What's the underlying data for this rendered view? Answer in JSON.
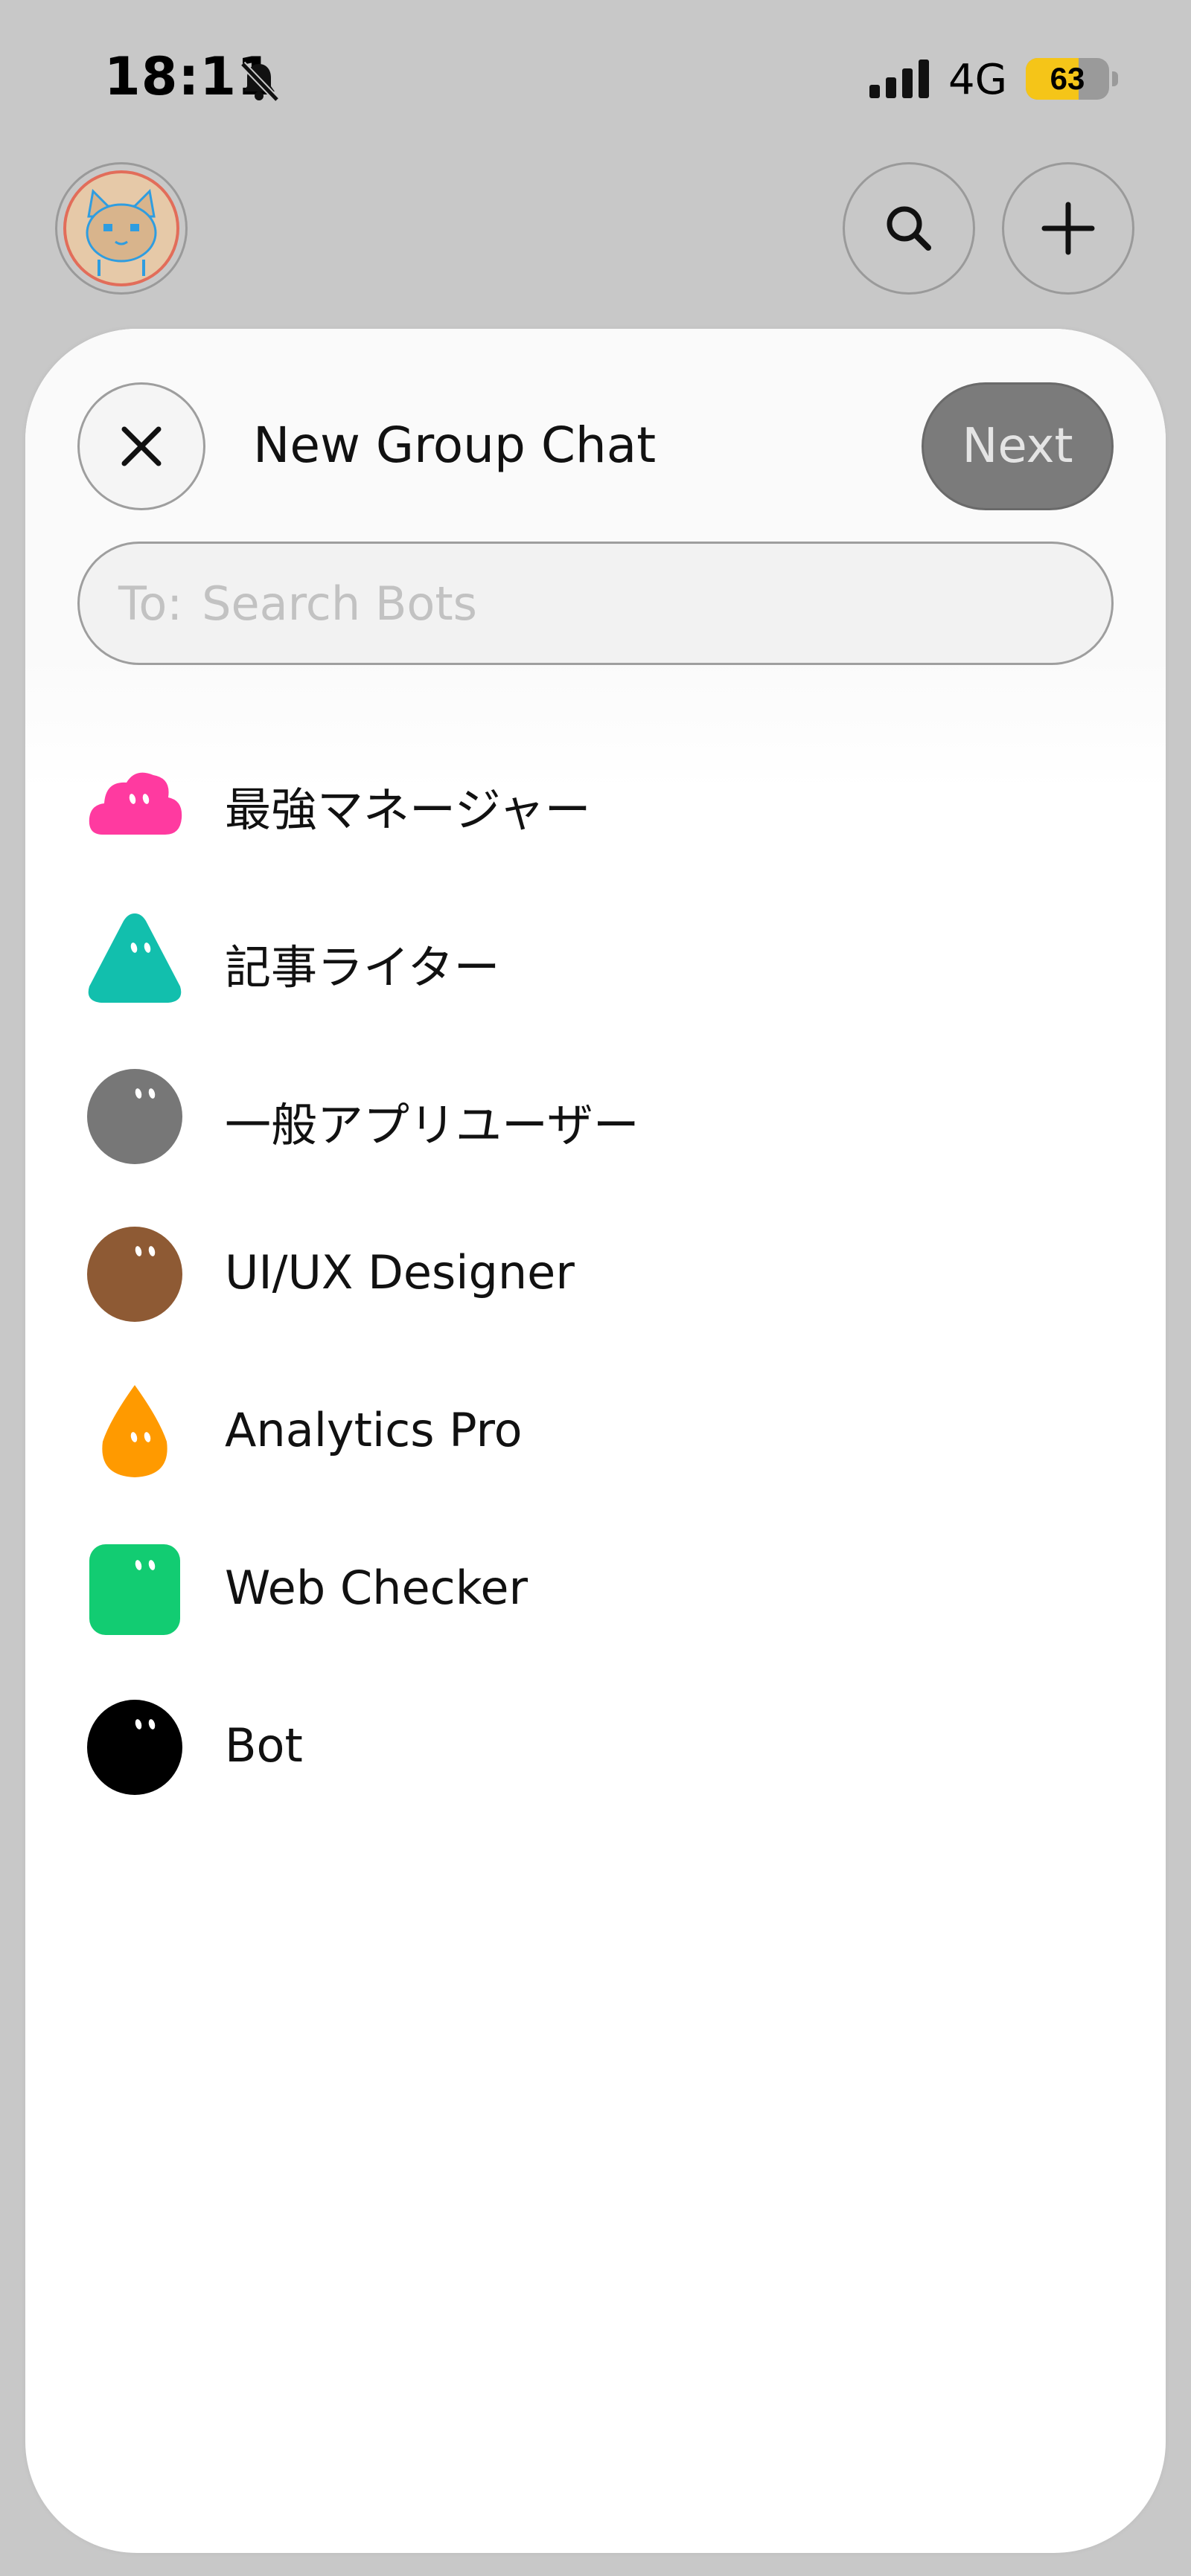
{
  "status_bar": {
    "time": "18:11",
    "network": "4G",
    "battery": "63",
    "battery_level": 0.63,
    "battery_color": "#f5c518",
    "icons": [
      "bell-slash-icon",
      "signal-bars-icon",
      "battery-icon"
    ]
  },
  "top_bar": {
    "avatar_icon": "cat-avatar-icon",
    "search_icon": "search-icon",
    "add_icon": "plus-icon"
  },
  "sheet": {
    "title": "New Group Chat",
    "close_icon": "close-icon",
    "next_label": "Next",
    "search": {
      "prefix": "To:",
      "placeholder": "Search Bots"
    }
  },
  "bots": [
    {
      "name": "最強マネージャー",
      "icon": "cloud-bot-icon",
      "color": "#ff3aa0"
    },
    {
      "name": "記事ライター",
      "icon": "triangle-bot-icon",
      "color": "#12bfad"
    },
    {
      "name": "一般アプリユーザー",
      "icon": "circle-bot-icon",
      "color": "#777777"
    },
    {
      "name": "UI/UX Designer",
      "icon": "circle-bot-icon",
      "color": "#8e5a34"
    },
    {
      "name": "Analytics Pro",
      "icon": "drop-bot-icon",
      "color": "#ff9a00"
    },
    {
      "name": "Web Checker",
      "icon": "square-bot-icon",
      "color": "#12cc72"
    },
    {
      "name": "Bot",
      "icon": "circle-bot-icon",
      "color": "#000000"
    }
  ]
}
